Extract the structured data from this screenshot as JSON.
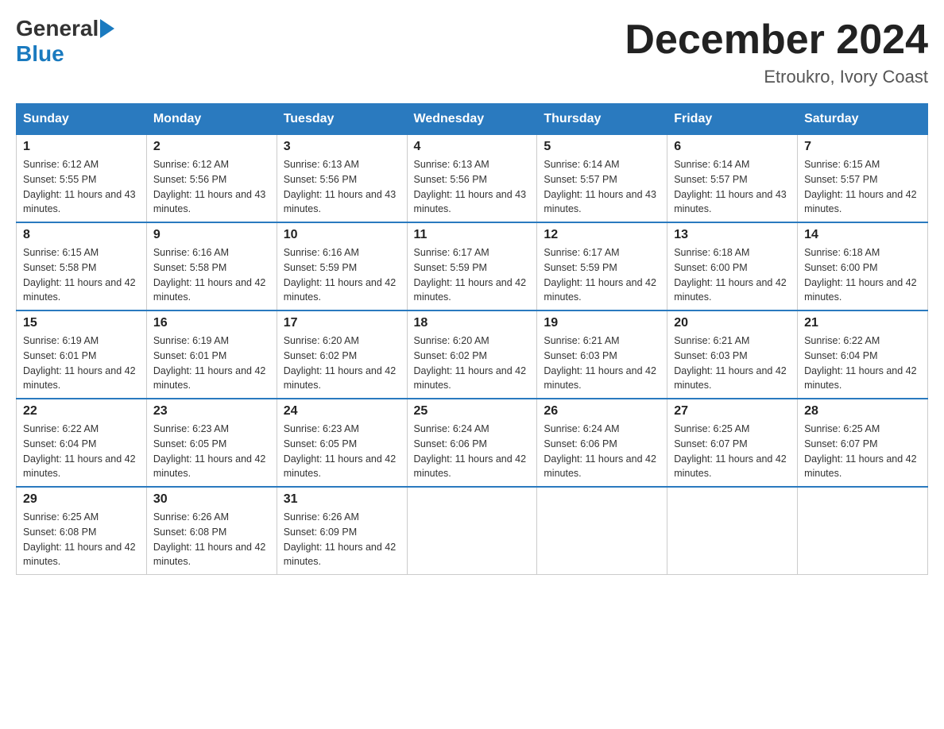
{
  "logo": {
    "general": "General",
    "blue": "Blue"
  },
  "header": {
    "month_year": "December 2024",
    "location": "Etroukro, Ivory Coast"
  },
  "weekdays": [
    "Sunday",
    "Monday",
    "Tuesday",
    "Wednesday",
    "Thursday",
    "Friday",
    "Saturday"
  ],
  "weeks": [
    [
      {
        "day": "1",
        "sunrise": "6:12 AM",
        "sunset": "5:55 PM",
        "daylight": "11 hours and 43 minutes."
      },
      {
        "day": "2",
        "sunrise": "6:12 AM",
        "sunset": "5:56 PM",
        "daylight": "11 hours and 43 minutes."
      },
      {
        "day": "3",
        "sunrise": "6:13 AM",
        "sunset": "5:56 PM",
        "daylight": "11 hours and 43 minutes."
      },
      {
        "day": "4",
        "sunrise": "6:13 AM",
        "sunset": "5:56 PM",
        "daylight": "11 hours and 43 minutes."
      },
      {
        "day": "5",
        "sunrise": "6:14 AM",
        "sunset": "5:57 PM",
        "daylight": "11 hours and 43 minutes."
      },
      {
        "day": "6",
        "sunrise": "6:14 AM",
        "sunset": "5:57 PM",
        "daylight": "11 hours and 43 minutes."
      },
      {
        "day": "7",
        "sunrise": "6:15 AM",
        "sunset": "5:57 PM",
        "daylight": "11 hours and 42 minutes."
      }
    ],
    [
      {
        "day": "8",
        "sunrise": "6:15 AM",
        "sunset": "5:58 PM",
        "daylight": "11 hours and 42 minutes."
      },
      {
        "day": "9",
        "sunrise": "6:16 AM",
        "sunset": "5:58 PM",
        "daylight": "11 hours and 42 minutes."
      },
      {
        "day": "10",
        "sunrise": "6:16 AM",
        "sunset": "5:59 PM",
        "daylight": "11 hours and 42 minutes."
      },
      {
        "day": "11",
        "sunrise": "6:17 AM",
        "sunset": "5:59 PM",
        "daylight": "11 hours and 42 minutes."
      },
      {
        "day": "12",
        "sunrise": "6:17 AM",
        "sunset": "5:59 PM",
        "daylight": "11 hours and 42 minutes."
      },
      {
        "day": "13",
        "sunrise": "6:18 AM",
        "sunset": "6:00 PM",
        "daylight": "11 hours and 42 minutes."
      },
      {
        "day": "14",
        "sunrise": "6:18 AM",
        "sunset": "6:00 PM",
        "daylight": "11 hours and 42 minutes."
      }
    ],
    [
      {
        "day": "15",
        "sunrise": "6:19 AM",
        "sunset": "6:01 PM",
        "daylight": "11 hours and 42 minutes."
      },
      {
        "day": "16",
        "sunrise": "6:19 AM",
        "sunset": "6:01 PM",
        "daylight": "11 hours and 42 minutes."
      },
      {
        "day": "17",
        "sunrise": "6:20 AM",
        "sunset": "6:02 PM",
        "daylight": "11 hours and 42 minutes."
      },
      {
        "day": "18",
        "sunrise": "6:20 AM",
        "sunset": "6:02 PM",
        "daylight": "11 hours and 42 minutes."
      },
      {
        "day": "19",
        "sunrise": "6:21 AM",
        "sunset": "6:03 PM",
        "daylight": "11 hours and 42 minutes."
      },
      {
        "day": "20",
        "sunrise": "6:21 AM",
        "sunset": "6:03 PM",
        "daylight": "11 hours and 42 minutes."
      },
      {
        "day": "21",
        "sunrise": "6:22 AM",
        "sunset": "6:04 PM",
        "daylight": "11 hours and 42 minutes."
      }
    ],
    [
      {
        "day": "22",
        "sunrise": "6:22 AM",
        "sunset": "6:04 PM",
        "daylight": "11 hours and 42 minutes."
      },
      {
        "day": "23",
        "sunrise": "6:23 AM",
        "sunset": "6:05 PM",
        "daylight": "11 hours and 42 minutes."
      },
      {
        "day": "24",
        "sunrise": "6:23 AM",
        "sunset": "6:05 PM",
        "daylight": "11 hours and 42 minutes."
      },
      {
        "day": "25",
        "sunrise": "6:24 AM",
        "sunset": "6:06 PM",
        "daylight": "11 hours and 42 minutes."
      },
      {
        "day": "26",
        "sunrise": "6:24 AM",
        "sunset": "6:06 PM",
        "daylight": "11 hours and 42 minutes."
      },
      {
        "day": "27",
        "sunrise": "6:25 AM",
        "sunset": "6:07 PM",
        "daylight": "11 hours and 42 minutes."
      },
      {
        "day": "28",
        "sunrise": "6:25 AM",
        "sunset": "6:07 PM",
        "daylight": "11 hours and 42 minutes."
      }
    ],
    [
      {
        "day": "29",
        "sunrise": "6:25 AM",
        "sunset": "6:08 PM",
        "daylight": "11 hours and 42 minutes."
      },
      {
        "day": "30",
        "sunrise": "6:26 AM",
        "sunset": "6:08 PM",
        "daylight": "11 hours and 42 minutes."
      },
      {
        "day": "31",
        "sunrise": "6:26 AM",
        "sunset": "6:09 PM",
        "daylight": "11 hours and 42 minutes."
      },
      null,
      null,
      null,
      null
    ]
  ],
  "labels": {
    "sunrise": "Sunrise: ",
    "sunset": "Sunset: ",
    "daylight": "Daylight: "
  }
}
